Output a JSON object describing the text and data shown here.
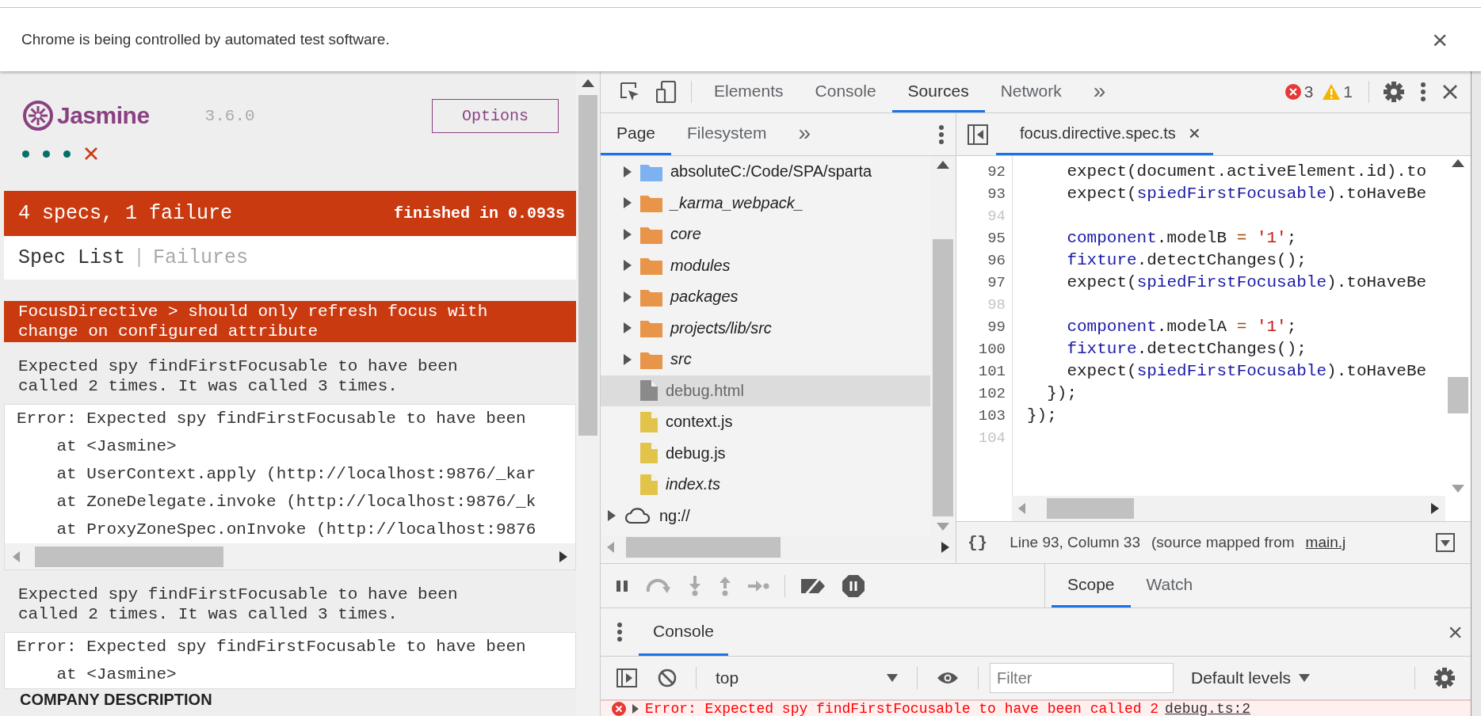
{
  "infobar": {
    "message": "Chrome is being controlled by automated test software.",
    "close": "×"
  },
  "jasmine": {
    "logo": "Jasmine",
    "version": "3.6.0",
    "options_button": "Options",
    "results": [
      {
        "failed": false
      },
      {
        "failed": false
      },
      {
        "failed": false
      },
      {
        "failed": true
      }
    ],
    "summary": {
      "text": "4 specs, 1 failure",
      "duration": "finished in 0.093s",
      "failed": true
    },
    "menu": [
      {
        "label": "Spec List",
        "selected": true
      },
      {
        "label": "Failures",
        "selected": false
      }
    ],
    "menu_separator": "|",
    "failure": {
      "title": "FocusDirective > should only refresh focus with change on configured attribute",
      "messages": [
        {
          "text": "Expected spy findFirstFocusable to have been called 2 times. It was called 3 times.",
          "stack": [
            "Error: Expected spy findFirstFocusable to have been",
            "    at <Jasmine>",
            "    at UserContext.apply (http://localhost:9876/_kar",
            "    at ZoneDelegate.invoke (http://localhost:9876/_k",
            "    at ProxyZoneSpec.onInvoke (http://localhost:9876"
          ],
          "scrollbar": true
        },
        {
          "text": "Expected spy findFirstFocusable to have been called 2 times. It was called 3 times.",
          "stack": [
            "Error: Expected spy findFirstFocusable to have been",
            "    at <Jasmine>"
          ],
          "scrollbar": false
        }
      ]
    },
    "page_text": "COMPANY DESCRIPTION"
  },
  "devtools": {
    "tabs": [
      {
        "label": "Elements",
        "selected": false
      },
      {
        "label": "Console",
        "selected": false
      },
      {
        "label": "Sources",
        "selected": true
      },
      {
        "label": "Network",
        "selected": false
      }
    ],
    "more_tabs": "»",
    "errors": "3",
    "warnings": "1",
    "navigator": {
      "tabs": [
        {
          "label": "Page",
          "selected": true
        },
        {
          "label": "Filesystem",
          "selected": false
        }
      ],
      "more_tabs": "»",
      "tree": [
        {
          "children": [
            {
              "label": "absoluteC:/Code/SPA/sparta",
              "kind": "folder",
              "color": "#7cb2f0",
              "italic": false,
              "expanded": false,
              "selected": false
            },
            {
              "label": "_karma_webpack_",
              "kind": "folder",
              "color": "#e8954a",
              "italic": true,
              "expanded": false,
              "selected": false
            },
            {
              "label": "core",
              "kind": "folder",
              "color": "#e8954a",
              "italic": true,
              "expanded": false,
              "selected": false
            },
            {
              "label": "modules",
              "kind": "folder",
              "color": "#e8954a",
              "italic": true,
              "expanded": false,
              "selected": false
            },
            {
              "label": "packages",
              "kind": "folder",
              "color": "#e8954a",
              "italic": true,
              "expanded": false,
              "selected": false
            },
            {
              "label": "projects/lib/src",
              "kind": "folder",
              "color": "#e8954a",
              "italic": true,
              "expanded": false,
              "selected": false
            },
            {
              "label": "src",
              "kind": "folder",
              "color": "#e8954a",
              "italic": true,
              "expanded": false,
              "selected": false
            },
            {
              "label": "debug.html",
              "kind": "file",
              "color": "#8a8a8a",
              "italic": false,
              "selected": true
            },
            {
              "label": "context.js",
              "kind": "file",
              "color": "#e3c44a",
              "italic": false,
              "selected": false
            },
            {
              "label": "debug.js",
              "kind": "file",
              "color": "#e3c44a",
              "italic": false,
              "selected": false
            },
            {
              "label": "index.ts",
              "kind": "file",
              "color": "#e3c44a",
              "italic": true,
              "selected": false
            }
          ]
        },
        {
          "label": "ng://",
          "kind": "cloud",
          "italic": false,
          "expanded": false,
          "selected": false
        }
      ]
    },
    "editor": {
      "file_tab": {
        "label": "focus.directive.spec.ts",
        "close": "×",
        "selected": true
      },
      "lines": [
        {
          "number": "92",
          "dim": false,
          "tokens": [
            {
              "kind": "plain",
              "text": "    expect(document.activeElement.id).to"
            }
          ]
        },
        {
          "number": "93",
          "dim": false,
          "tokens": [
            {
              "kind": "plain",
              "text": "    expect("
            },
            {
              "kind": "variable",
              "text": "spiedFirstFocusable"
            },
            {
              "kind": "plain",
              "text": ").toHaveBe"
            }
          ]
        },
        {
          "number": "94",
          "dim": true
        },
        {
          "number": "95",
          "dim": false,
          "tokens": [
            {
              "kind": "variable",
              "text": "    component"
            },
            {
              "kind": "plain",
              "text": ".modelB "
            },
            {
              "kind": "operator",
              "text": "= "
            },
            {
              "kind": "string",
              "text": "'1'"
            },
            {
              "kind": "plain",
              "text": ";"
            }
          ]
        },
        {
          "number": "96",
          "dim": false,
          "tokens": [
            {
              "kind": "variable",
              "text": "    fixture"
            },
            {
              "kind": "plain",
              "text": ".detectChanges();"
            }
          ]
        },
        {
          "number": "97",
          "dim": false,
          "tokens": [
            {
              "kind": "plain",
              "text": "    expect("
            },
            {
              "kind": "variable",
              "text": "spiedFirstFocusable"
            },
            {
              "kind": "plain",
              "text": ").toHaveBe"
            }
          ]
        },
        {
          "number": "98",
          "dim": true
        },
        {
          "number": "99",
          "dim": false,
          "tokens": [
            {
              "kind": "variable",
              "text": "    component"
            },
            {
              "kind": "plain",
              "text": ".modelA "
            },
            {
              "kind": "operator",
              "text": "= "
            },
            {
              "kind": "string",
              "text": "'1'"
            },
            {
              "kind": "plain",
              "text": ";"
            }
          ]
        },
        {
          "number": "100",
          "dim": false,
          "tokens": [
            {
              "kind": "variable",
              "text": "    fixture"
            },
            {
              "kind": "plain",
              "text": ".detectChanges();"
            }
          ]
        },
        {
          "number": "101",
          "dim": false,
          "tokens": [
            {
              "kind": "plain",
              "text": "    expect("
            },
            {
              "kind": "variable",
              "text": "spiedFirstFocusable"
            },
            {
              "kind": "plain",
              "text": ").toHaveBe"
            }
          ]
        },
        {
          "number": "102",
          "dim": false,
          "tokens": [
            {
              "kind": "plain",
              "text": "  });"
            }
          ]
        },
        {
          "number": "103",
          "dim": false,
          "tokens": [
            {
              "kind": "plain",
              "text": "});"
            }
          ]
        },
        {
          "number": "104",
          "dim": true
        }
      ],
      "status": {
        "format": "{}",
        "position": "Line 93, Column 33",
        "mapped": "(source mapped from",
        "link": "main.j"
      }
    },
    "debugger": {
      "side_tabs": [
        {
          "label": "Scope",
          "selected": true
        },
        {
          "label": "Watch",
          "selected": false
        }
      ]
    },
    "drawer": {
      "tabs": [
        {
          "label": "Console",
          "selected": true
        }
      ],
      "close": "×"
    },
    "console": {
      "context": "top",
      "filter_placeholder": "Filter",
      "levels": "Default levels",
      "messages": [
        {
          "kind": "error",
          "text": "Error: Expected spy findFirstFocusable to have been called 2",
          "source": "debug.ts:2"
        }
      ]
    }
  }
}
